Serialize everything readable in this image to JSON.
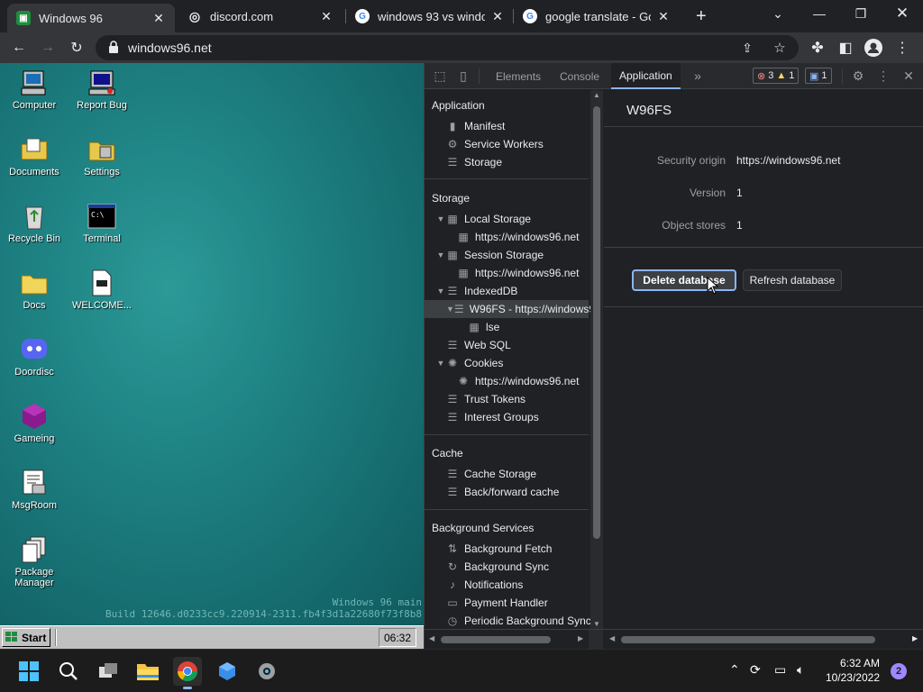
{
  "browser": {
    "tabs": [
      {
        "title": "Windows 96",
        "active": true
      },
      {
        "title": "discord.com",
        "active": false
      },
      {
        "title": "windows 93 vs window",
        "active": false
      },
      {
        "title": "google translate - Goo",
        "active": false
      }
    ],
    "new_tab": "+",
    "url": "windows96.net"
  },
  "desktop": {
    "icons": [
      {
        "label": "Computer",
        "icon": "computer-icon"
      },
      {
        "label": "Report Bug",
        "icon": "report-bug-icon"
      },
      {
        "label": "Documents",
        "icon": "documents-folder-icon"
      },
      {
        "label": "Settings",
        "icon": "settings-icon"
      },
      {
        "label": "Recycle Bin",
        "icon": "recycle-bin-icon"
      },
      {
        "label": "Terminal",
        "icon": "terminal-icon"
      },
      {
        "label": "Docs",
        "icon": "folder-icon"
      },
      {
        "label": "WELCOME...",
        "icon": "markdown-file-icon"
      },
      {
        "label": "Doordisc",
        "icon": "doordisc-icon"
      },
      {
        "label": "Gameing",
        "icon": "gameing-icon"
      },
      {
        "label": "MsgRoom",
        "icon": "msgroom-icon"
      },
      {
        "label": "Package Manager",
        "icon": "package-manager-icon"
      }
    ],
    "build_line1": "Windows 96 main",
    "build_line2": "Build 12646.d0233cc9.220914-2311.fb4f3d1a22680f73f8b8",
    "start_label": "Start",
    "clock": "06:32"
  },
  "devtools": {
    "tabs": [
      "Elements",
      "Console",
      "Application"
    ],
    "active_tab": "Application",
    "more": "»",
    "errors": "3",
    "warnings": "1",
    "messages": "1",
    "sidebar": {
      "application_header": "Application",
      "application_items": [
        "Manifest",
        "Service Workers",
        "Storage"
      ],
      "storage_header": "Storage",
      "local_storage": "Local Storage",
      "local_storage_origin": "https://windows96.net",
      "session_storage": "Session Storage",
      "session_storage_origin": "https://windows96.net",
      "indexeddb": "IndexedDB",
      "indexeddb_db": "W96FS - https://windows96.net",
      "indexeddb_store": "lse",
      "web_sql": "Web SQL",
      "cookies": "Cookies",
      "cookies_origin": "https://windows96.net",
      "trust_tokens": "Trust Tokens",
      "interest_groups": "Interest Groups",
      "cache_header": "Cache",
      "cache_storage": "Cache Storage",
      "bf_cache": "Back/forward cache",
      "bg_header": "Background Services",
      "bg_items": [
        "Background Fetch",
        "Background Sync",
        "Notifications",
        "Payment Handler",
        "Periodic Background Sync"
      ]
    },
    "main": {
      "db_name": "W96FS",
      "security_origin_label": "Security origin",
      "security_origin": "https://windows96.net",
      "version_label": "Version",
      "version": "1",
      "object_stores_label": "Object stores",
      "object_stores": "1",
      "delete_button": "Delete database",
      "refresh_button": "Refresh database"
    }
  },
  "taskbar": {
    "time": "6:32 AM",
    "date": "10/23/2022",
    "notifications": "2"
  }
}
